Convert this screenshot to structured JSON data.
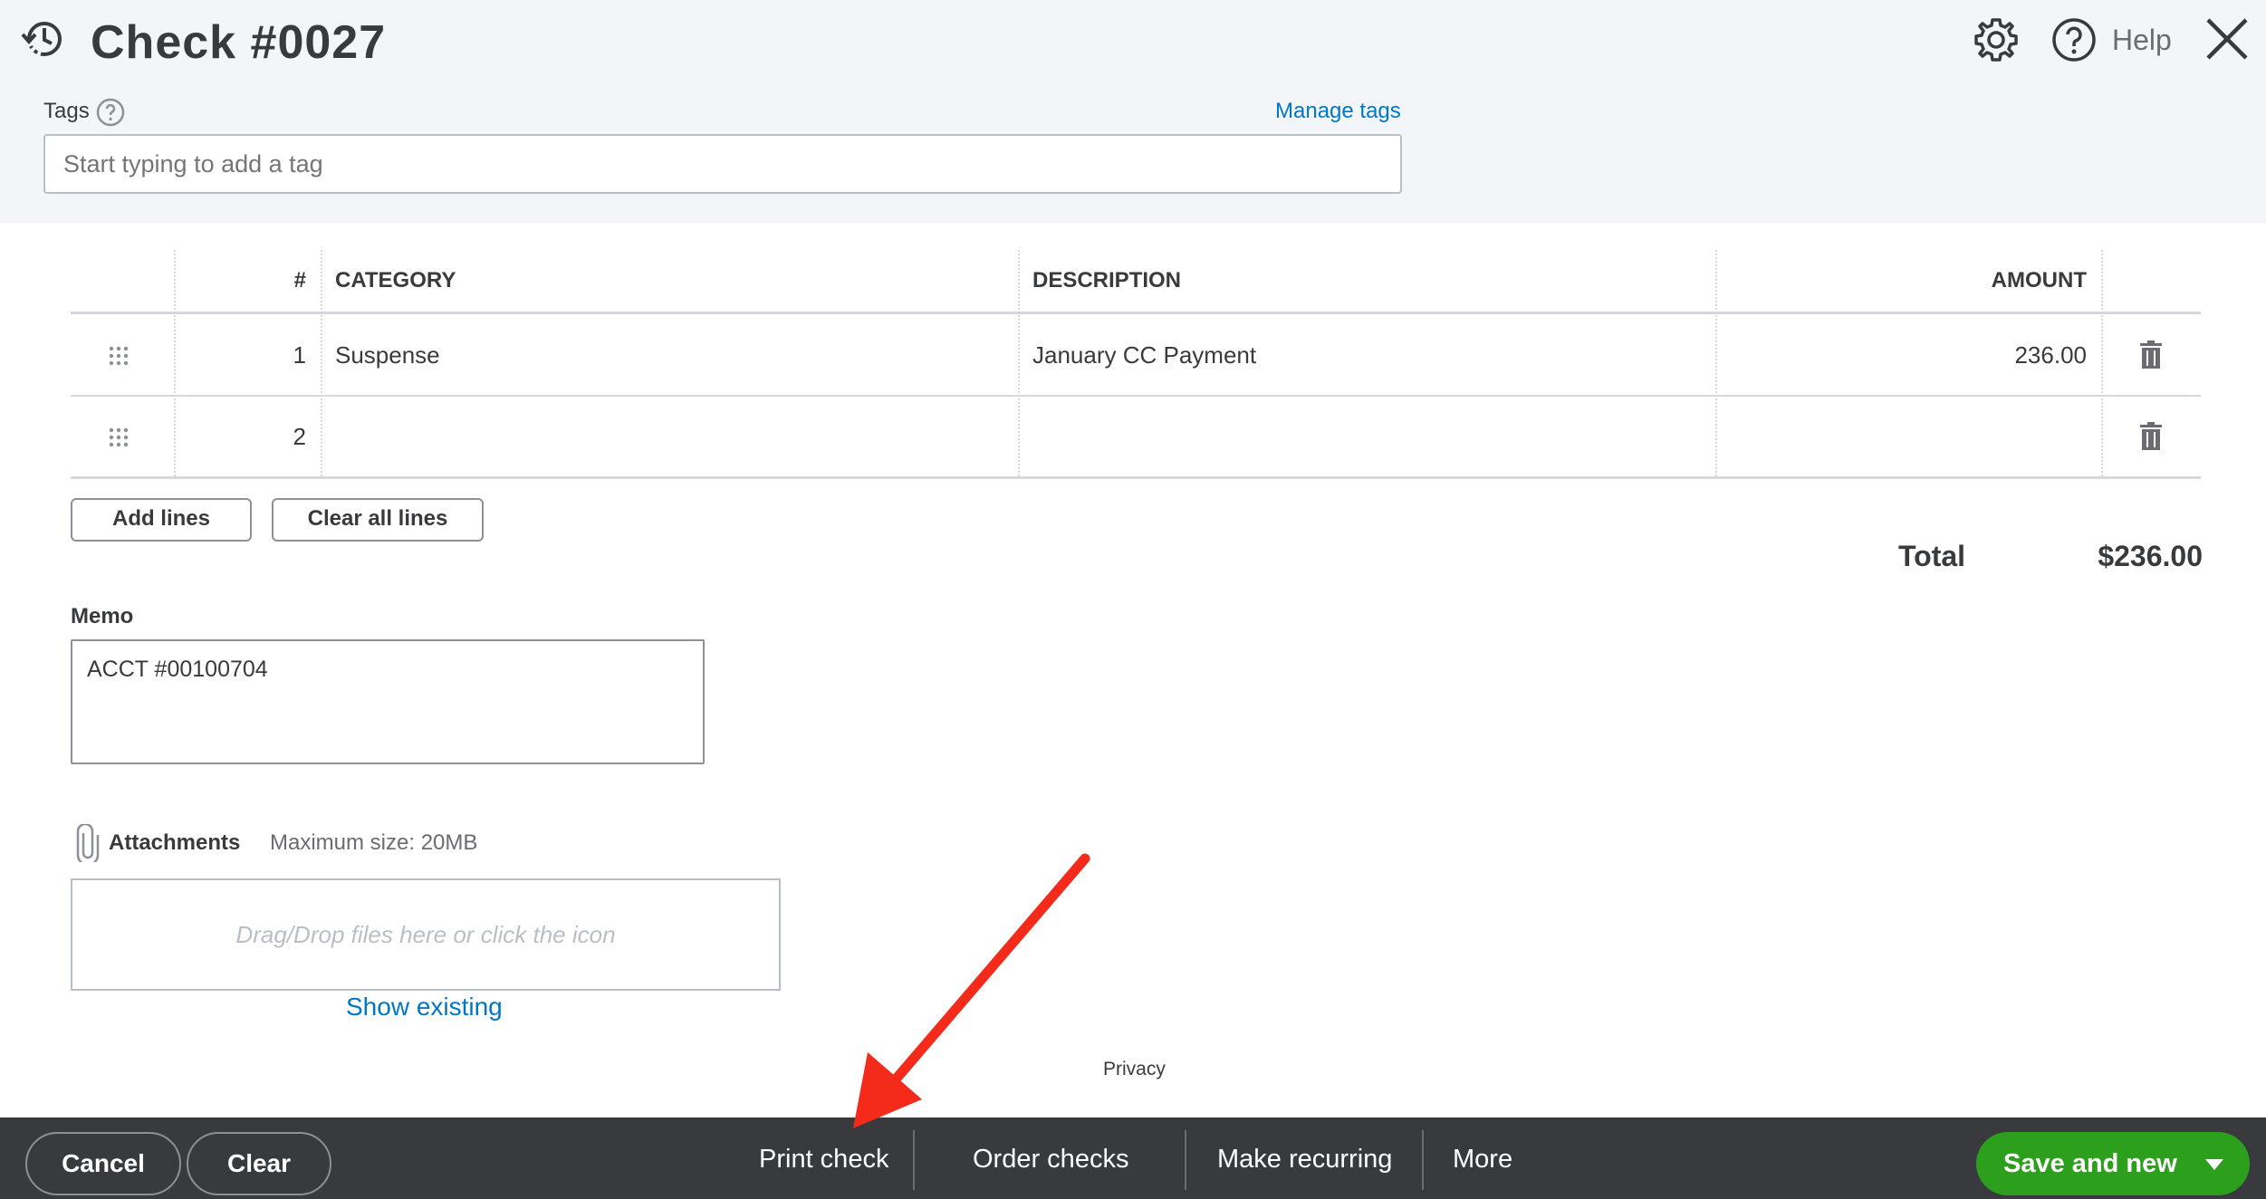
{
  "header": {
    "title": "Check #0027",
    "help_label": "Help",
    "icons": [
      "history-icon",
      "gear-icon",
      "help-icon",
      "close-icon"
    ]
  },
  "tags": {
    "label": "Tags",
    "manage_label": "Manage tags",
    "placeholder": "Start typing to add a tag"
  },
  "table": {
    "columns": [
      "#",
      "CATEGORY",
      "DESCRIPTION",
      "AMOUNT"
    ],
    "rows": [
      {
        "num": "1",
        "category": "Suspense",
        "description": "January CC Payment",
        "amount": "236.00"
      },
      {
        "num": "2",
        "category": "",
        "description": "",
        "amount": ""
      }
    ]
  },
  "buttons": {
    "add_lines": "Add lines",
    "clear_all_lines": "Clear all lines"
  },
  "total": {
    "label": "Total",
    "value": "$236.00"
  },
  "memo": {
    "label": "Memo",
    "value": "ACCT #00100704"
  },
  "attachments": {
    "label": "Attachments",
    "max_size": "Maximum size: 20MB",
    "dropzone_text": "Drag/Drop files here or click the icon",
    "show_existing": "Show existing"
  },
  "privacy": "Privacy",
  "footer": {
    "cancel": "Cancel",
    "clear": "Clear",
    "print_check": "Print check",
    "order_checks": "Order checks",
    "make_recurring": "Make recurring",
    "more": "More",
    "save_and_new": "Save and new"
  },
  "colors": {
    "brand_green": "#2ca01c",
    "link_blue": "#0077c5",
    "footer_bg": "#393a3d",
    "annotation_arrow": "#f42a1b"
  }
}
